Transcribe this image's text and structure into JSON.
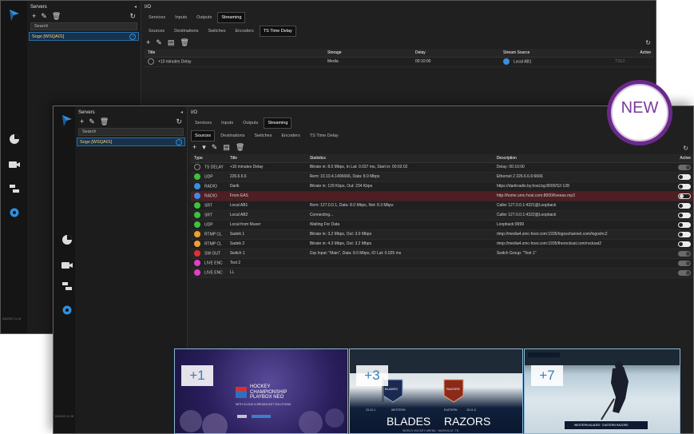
{
  "back_window": {
    "servers_title": "Servers",
    "search_placeholder": "Search",
    "server_item": "Sogo [WSQA01]",
    "io_title": "I/O",
    "main_tabs": [
      "Services",
      "Inputs",
      "Outputs",
      "Streaming"
    ],
    "sub_tabs": [
      "Sources",
      "Destinations",
      "Switches",
      "Encoders",
      "TS Time Delay"
    ],
    "columns": [
      "Title",
      "Storage",
      "Delay",
      "Stream Source",
      "Active"
    ],
    "row": {
      "title": "+10 minutes Delay",
      "storage": "Media",
      "delay": "00:10:00",
      "source": "Local AB1",
      "extra": "TSE2"
    },
    "footer": "6/6/2020 11:18"
  },
  "front_window": {
    "servers_title": "Servers",
    "search_placeholder": "Search",
    "server_item": "Sogo [WSQA01]",
    "io_title": "I/O",
    "main_tabs": [
      "Services",
      "Inputs",
      "Outputs",
      "Streaming"
    ],
    "sub_tabs": [
      "Sources",
      "Destinations",
      "Switches",
      "Encoders",
      "TS Time Delay"
    ],
    "columns": [
      "Type",
      "Title",
      "Statistics",
      "Description",
      "Active"
    ],
    "rows": [
      {
        "type": "TS DELAY",
        "color": "",
        "title": "+10 minutes Delay",
        "stats": "Bitrate in: 8.0 Mbps, In Lat: 0.037 ms, Start in: 00:02:02",
        "desc": "Delay: 00:10:00",
        "toggle": "dim"
      },
      {
        "type": "UDP",
        "color": "#3cc23c",
        "title": "226.6.6.6",
        "stats": "Rem: 10.10.4.1406666, Data: 8.0 Mbps",
        "desc": "Ethernet 2 226.6.6.6:6666",
        "toggle": "on"
      },
      {
        "type": "RADIO",
        "color": "#3b8de0",
        "title": "Darik",
        "stats": "Bitrate in: 129 Kbps, Out: 234 Kbps",
        "desc": "https://darikradio.by.host.bg:8000/S2-128",
        "toggle": "on"
      },
      {
        "type": "RADIO",
        "color": "#3b8de0",
        "title": "From EAS",
        "stats": "",
        "desc": "http://home.smc-host.com:8000/liveeas.mp3",
        "toggle": "off"
      },
      {
        "type": "SRT",
        "color": "#3cc23c",
        "title": "Local AB1",
        "stats": "Rem: 127.0.0.1, Data: 8.0 Mbps, Net: 8.3 Mbps",
        "desc": "Caller 127.0.0.1:4321@Loopback",
        "toggle": "on"
      },
      {
        "type": "SRT",
        "color": "#3cc23c",
        "title": "Local AB2",
        "stats": "Connecting...",
        "desc": "Caller 127.0.0.1:4322@Loopback",
        "toggle": "on"
      },
      {
        "type": "UDP",
        "color": "#3cc23c",
        "title": "Local from Muxer",
        "stats": "Waiting For Data",
        "desc": "Loopback:9999",
        "toggle": "on"
      },
      {
        "type": "RTMP CL",
        "color": "#f0a030",
        "title": "Sadek 1",
        "stats": "Bitrate in: 3.2 Mbps, Out: 3.0 Mbps",
        "desc": "rtmp://media4.smc-host.com:1935/logoschannel.com/logoshc2",
        "toggle": "on"
      },
      {
        "type": "RTMP CL",
        "color": "#f0a030",
        "title": "Sadek 2",
        "stats": "Bitrate in: 4.3 Mbps, Out: 3.2 Mbps",
        "desc": "rtmp://media4.smc-host.com:1935/therocksat.com/rocksat2",
        "toggle": "on"
      },
      {
        "type": "SW OUT",
        "color": "#e03030",
        "title": "Switch 1",
        "stats": "Grp Input: \"Main\", Data: 8.0 Mbps, IO Lat: 0.025 ms",
        "desc": "Switch Group: \"Test 1\"",
        "toggle": "dim"
      },
      {
        "type": "LIVE ENC",
        "color": "#e040c8",
        "title": "Test 2",
        "stats": "",
        "desc": "",
        "toggle": "dim"
      },
      {
        "type": "LIVE ENC",
        "color": "#e040c8",
        "title": "LL",
        "stats": "",
        "desc": "",
        "toggle": "dim"
      }
    ],
    "footer": "6/6/2020 11:18"
  },
  "badge": {
    "text": "NEW"
  },
  "thumbnails": [
    {
      "plus": "+1",
      "headline": "HOCKEY CHAMPIONSHIP PLAYBOX NEO",
      "sub": "WITH CLOUD & BROADCAST SOLUTIONS"
    },
    {
      "plus": "+3",
      "team_left": "BLADES",
      "team_right": "RAZORS",
      "arena": "WORLD HOCKEY ARENA · NASHVILLE, TN",
      "score_left": "23-10-1",
      "score_right": "15-11-5",
      "label_left": "WESTERN",
      "label_right": "EASTERN"
    },
    {
      "plus": "+7",
      "ticker": "WESTERN BLADES · EASTERN RAZORS"
    }
  ],
  "colors": {
    "accent": "#2f8fe0",
    "highlight_row": "#4e1e22",
    "server_item_text": "#ffd37a"
  }
}
